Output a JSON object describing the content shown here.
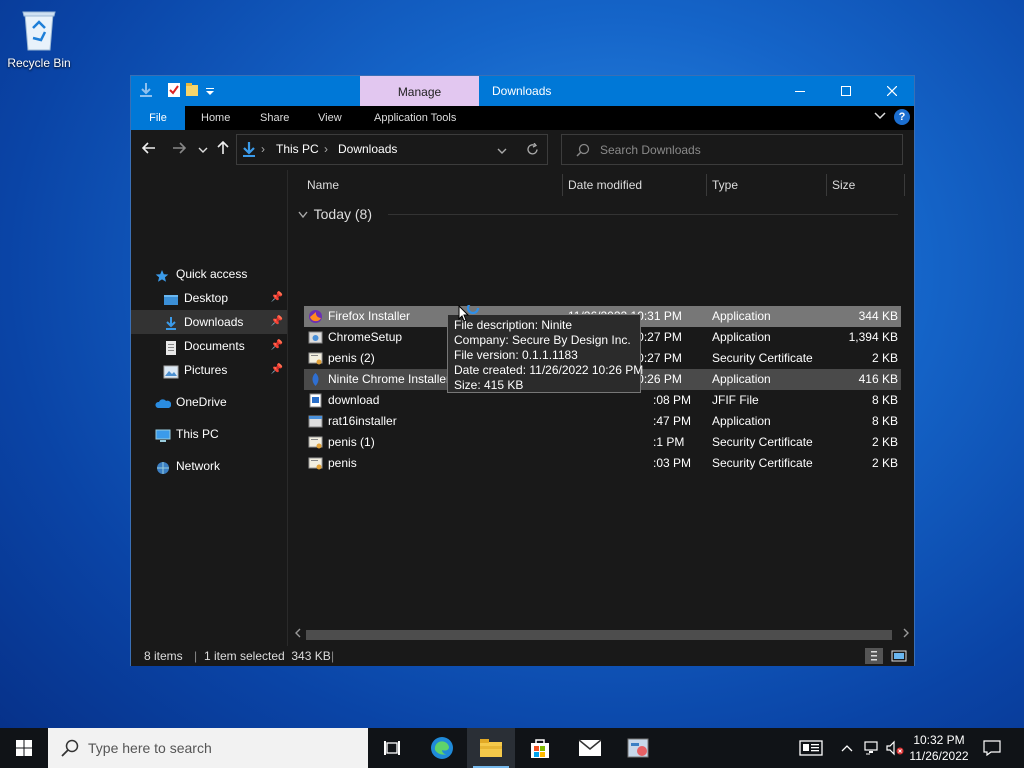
{
  "desktop": {
    "recycle_bin_label": "Recycle Bin"
  },
  "window": {
    "title": "Downloads",
    "manage_tab": "Manage",
    "ribbon_tabs": [
      "File",
      "Home",
      "Share",
      "View",
      "Application Tools"
    ],
    "help": "?"
  },
  "address": {
    "crumbs": [
      "This PC",
      "Downloads"
    ],
    "search_placeholder": "Search Downloads"
  },
  "nav": {
    "quick_access": "Quick access",
    "desktop": "Desktop",
    "downloads": "Downloads",
    "documents": "Documents",
    "pictures": "Pictures",
    "onedrive": "OneDrive",
    "this_pc": "This PC",
    "network": "Network"
  },
  "columns": {
    "name": "Name",
    "date": "Date modified",
    "type": "Type",
    "size": "Size"
  },
  "group": {
    "label": "Today (8)"
  },
  "files": [
    {
      "name": "Firefox Installer",
      "date": "11/26/2022 10:31 PM",
      "type": "Application",
      "size": "344 KB"
    },
    {
      "name": "ChromeSetup",
      "date": "11/26/2022 10:27 PM",
      "type": "Application",
      "size": "1,394 KB"
    },
    {
      "name": "penis (2)",
      "date": "11/26/2022 10:27 PM",
      "type": "Security Certificate",
      "size": "2 KB"
    },
    {
      "name": "Ninite Chrome Installer",
      "date": "11/26/2022 10:26 PM",
      "type": "Application",
      "size": "416 KB"
    },
    {
      "name": "download",
      "date": ":08 PM",
      "type": "JFIF File",
      "size": "8 KB"
    },
    {
      "name": "rat16installer",
      "date": ":47 PM",
      "type": "Application",
      "size": "8 KB"
    },
    {
      "name": "penis (1)",
      "date": ":1 PM",
      "type": "Security Certificate",
      "size": "2 KB"
    },
    {
      "name": "penis",
      "date": ":03 PM",
      "type": "Security Certificate",
      "size": "2 KB"
    }
  ],
  "tooltip": {
    "line1": "File description: Ninite",
    "line2": "Company: Secure By Design Inc.",
    "line3": "File version: 0.1.1.1183",
    "line4": "Date created: 11/26/2022 10:26 PM",
    "line5": "Size: 415 KB"
  },
  "status": {
    "items": "8 items",
    "selected": "1 item selected  343 KB"
  },
  "taskbar": {
    "search_placeholder": "Type here to search",
    "time": "10:32 PM",
    "date": "11/26/2022"
  },
  "colors": {
    "accent": "#0078d7",
    "manage_tab": "#e2c7f0",
    "window_bg": "#191919",
    "selection": "#777777"
  }
}
